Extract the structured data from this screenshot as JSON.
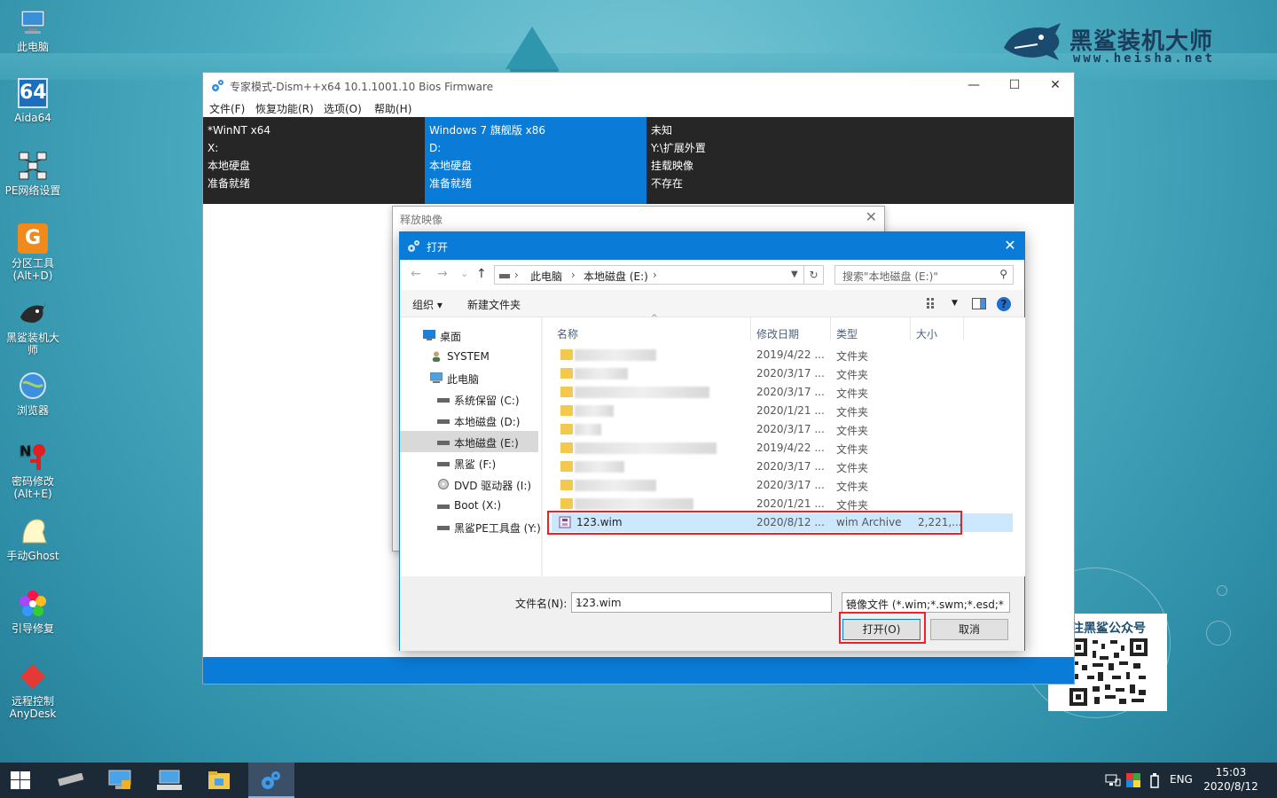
{
  "desktop": {
    "icons": [
      {
        "label": "此电脑"
      },
      {
        "label": "Aida64"
      },
      {
        "label": "PE网络设置"
      },
      {
        "label": "分区工具\n(Alt+D)",
        "line1": "分区工具",
        "line2": "(Alt+D)"
      },
      {
        "label": "黑鲨装机大师",
        "line1": "黑鲨装机大",
        "line2": "师"
      },
      {
        "label": "浏览器"
      },
      {
        "label": "密码修改",
        "line1": "密码修改",
        "line2": "(Alt+E)"
      },
      {
        "label": "手动Ghost"
      },
      {
        "label": "引导修复"
      },
      {
        "label": "远程控制",
        "line1": "远程控制",
        "line2": "AnyDesk"
      }
    ],
    "aida_badge": "64",
    "brand": {
      "name": "黑鲨装机大师",
      "url": "www.heisha.net"
    },
    "qr_title": "注黑鲨公众号"
  },
  "dism": {
    "title": "专家模式-Dism++x64 10.1.1001.10 Bios Firmware",
    "menu": [
      "文件(F)",
      "恢复功能(R)",
      "选项(O)",
      "帮助(H)"
    ],
    "panels": [
      {
        "lines": [
          "*WinNT x64",
          "X:",
          "本地硬盘",
          "准备就绪"
        ]
      },
      {
        "lines": [
          "Windows 7 旗舰版 x86",
          "D:",
          "本地硬盘",
          "准备就绪"
        ]
      },
      {
        "lines": [
          "未知",
          "Y:\\扩展外置",
          "挂载映像",
          "不存在"
        ]
      }
    ],
    "win_controls": {
      "minimize": "—",
      "maximize": "☐",
      "close": "✕"
    }
  },
  "release_dialog": {
    "title": "释放映像",
    "close": "✕"
  },
  "open_dialog": {
    "title": "打开",
    "close": "✕",
    "nav": {
      "back": "←",
      "forward": "→",
      "recent": "⌄",
      "up": "↑"
    },
    "address": {
      "parts": [
        "此电脑",
        "本地磁盘 (E:)"
      ],
      "sep": "›",
      "refresh": "↻"
    },
    "search_placeholder": "搜索\"本地磁盘 (E:)\"",
    "search_icon": "⚲",
    "toolbar": {
      "organize": "组织 ▾",
      "new_folder": "新建文件夹",
      "help": "?"
    },
    "nav_tree": [
      {
        "label": "桌面",
        "icon": "desktop-icon"
      },
      {
        "label": "SYSTEM",
        "icon": "user-icon"
      },
      {
        "label": "此电脑",
        "icon": "computer-icon"
      },
      {
        "label": "系统保留 (C:)",
        "icon": "drive-icon"
      },
      {
        "label": "本地磁盘 (D:)",
        "icon": "drive-icon"
      },
      {
        "label": "本地磁盘 (E:)",
        "icon": "drive-icon",
        "selected": true
      },
      {
        "label": "黑鲨 (F:)",
        "icon": "drive-icon"
      },
      {
        "label": "DVD 驱动器 (I:)",
        "icon": "dvd-icon"
      },
      {
        "label": "Boot (X:)",
        "icon": "drive-icon"
      },
      {
        "label": "黑鲨PE工具盘 (Y:)",
        "icon": "drive-icon"
      }
    ],
    "columns": [
      "名称",
      "修改日期",
      "类型",
      "大小"
    ],
    "files": [
      {
        "date": "2019/4/22 ...",
        "type": "文件夹",
        "size": ""
      },
      {
        "date": "2020/3/17 ...",
        "type": "文件夹",
        "size": ""
      },
      {
        "date": "2020/3/17 ...",
        "type": "文件夹",
        "size": ""
      },
      {
        "date": "2020/1/21 ...",
        "type": "文件夹",
        "size": ""
      },
      {
        "date": "2020/3/17 ...",
        "type": "文件夹",
        "size": ""
      },
      {
        "date": "2019/4/22 ...",
        "type": "文件夹",
        "size": ""
      },
      {
        "date": "2020/3/17 ...",
        "type": "文件夹",
        "size": ""
      },
      {
        "date": "2020/3/17 ...",
        "type": "文件夹",
        "size": ""
      },
      {
        "date": "2020/1/21 ...",
        "type": "文件夹",
        "size": ""
      },
      {
        "name": "123.wim",
        "date": "2020/8/12 ...",
        "type": "wim Archive",
        "size": "2,221,...",
        "selected": true
      }
    ],
    "filename_label": "文件名(N):",
    "filename_value": "123.wim",
    "filetype_value": "镜像文件 (*.wim;*.swm;*.esd;*",
    "open_button": "打开(O)",
    "cancel_button": "取消"
  },
  "taskbar": {
    "tray_lang": "ENG",
    "time": "15:03",
    "date": "2020/8/12"
  },
  "colors": {
    "accent": "#0a7bd6",
    "highlight": "#e8232a",
    "taskbar": "#1c2a38"
  }
}
